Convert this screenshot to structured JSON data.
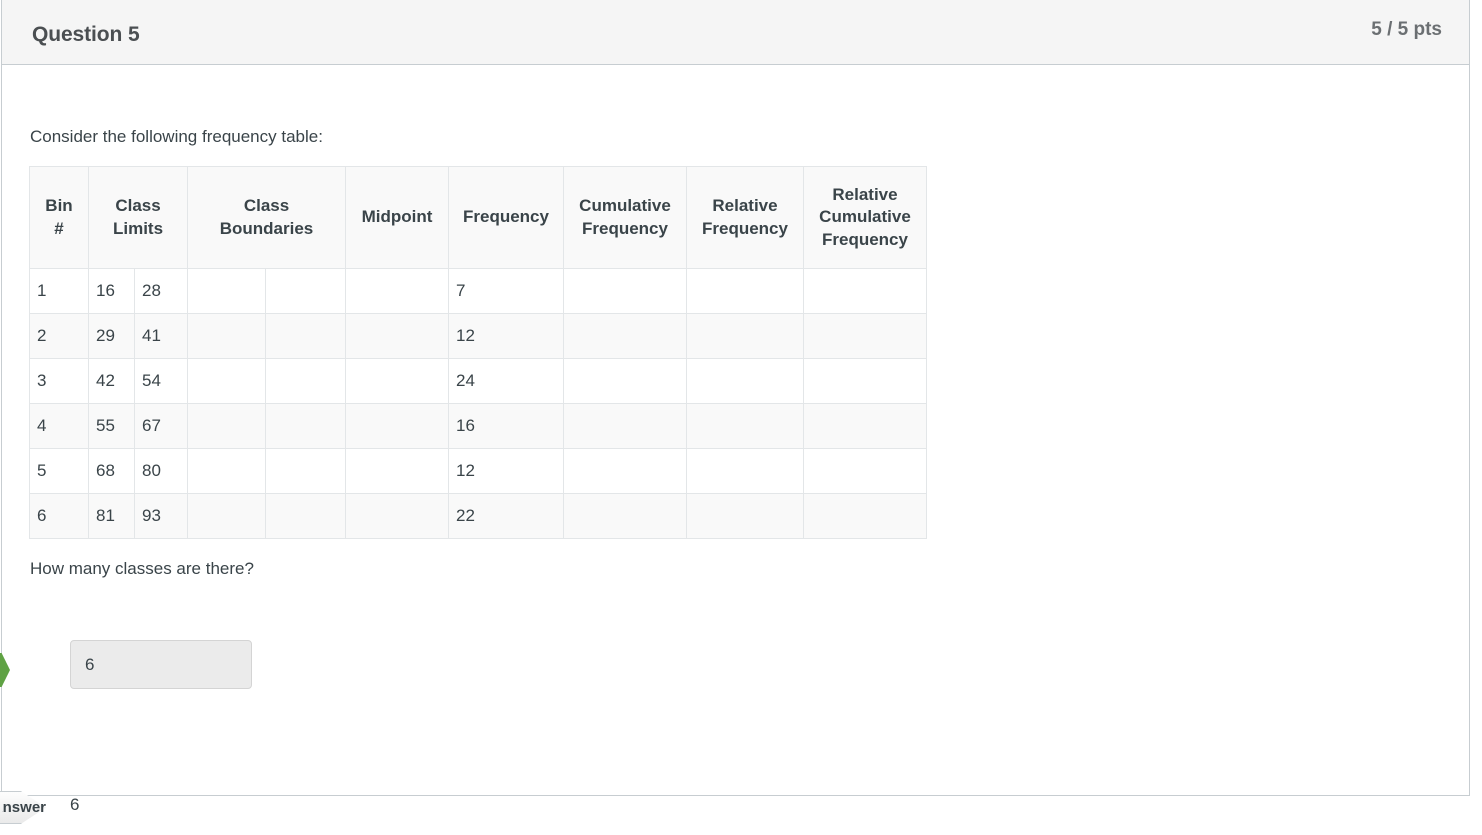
{
  "header": {
    "question_name": "Question 5",
    "points": "5 / 5 pts"
  },
  "body": {
    "intro_text": "Consider the following frequency table:",
    "prompt_text": "How many classes are there?"
  },
  "freq_table": {
    "headers": {
      "bin": "Bin\n#",
      "class_limits": "Class\nLimits",
      "class_boundaries": "Class\nBoundaries",
      "midpoint": "Midpoint",
      "frequency": "Frequency",
      "cumulative_frequency": "Cumulative\nFrequency",
      "relative_frequency": "Relative\nFrequency",
      "relative_cumulative_frequency": "Relative\nCumulative\nFrequency"
    },
    "rows": [
      {
        "bin": "1",
        "limit_lower": "16",
        "limit_upper": "28",
        "bound_lower": "",
        "bound_upper": "",
        "midpoint": "",
        "frequency": "7",
        "cum_freq": "",
        "rel_freq": "",
        "rel_cum_freq": ""
      },
      {
        "bin": "2",
        "limit_lower": "29",
        "limit_upper": "41",
        "bound_lower": "",
        "bound_upper": "",
        "midpoint": "",
        "frequency": "12",
        "cum_freq": "",
        "rel_freq": "",
        "rel_cum_freq": ""
      },
      {
        "bin": "3",
        "limit_lower": "42",
        "limit_upper": "54",
        "bound_lower": "",
        "bound_upper": "",
        "midpoint": "",
        "frequency": "24",
        "cum_freq": "",
        "rel_freq": "",
        "rel_cum_freq": ""
      },
      {
        "bin": "4",
        "limit_lower": "55",
        "limit_upper": "67",
        "bound_lower": "",
        "bound_upper": "",
        "midpoint": "",
        "frequency": "16",
        "cum_freq": "",
        "rel_freq": "",
        "rel_cum_freq": ""
      },
      {
        "bin": "5",
        "limit_lower": "68",
        "limit_upper": "80",
        "bound_lower": "",
        "bound_upper": "",
        "midpoint": "",
        "frequency": "12",
        "cum_freq": "",
        "rel_freq": "",
        "rel_cum_freq": ""
      },
      {
        "bin": "6",
        "limit_lower": "81",
        "limit_upper": "93",
        "bound_lower": "",
        "bound_upper": "",
        "midpoint": "",
        "frequency": "22",
        "cum_freq": "",
        "rel_freq": "",
        "rel_cum_freq": ""
      }
    ]
  },
  "answer": {
    "student_answer_value": "6",
    "student_answer_placeholder": "",
    "correct_tag_label": "Answer",
    "correct_answer_value": "6"
  },
  "colors": {
    "correct_marker_green": "#5fa244",
    "header_background": "#f5f5f5",
    "border": "#c7cdd1",
    "text": "#3a4449"
  }
}
